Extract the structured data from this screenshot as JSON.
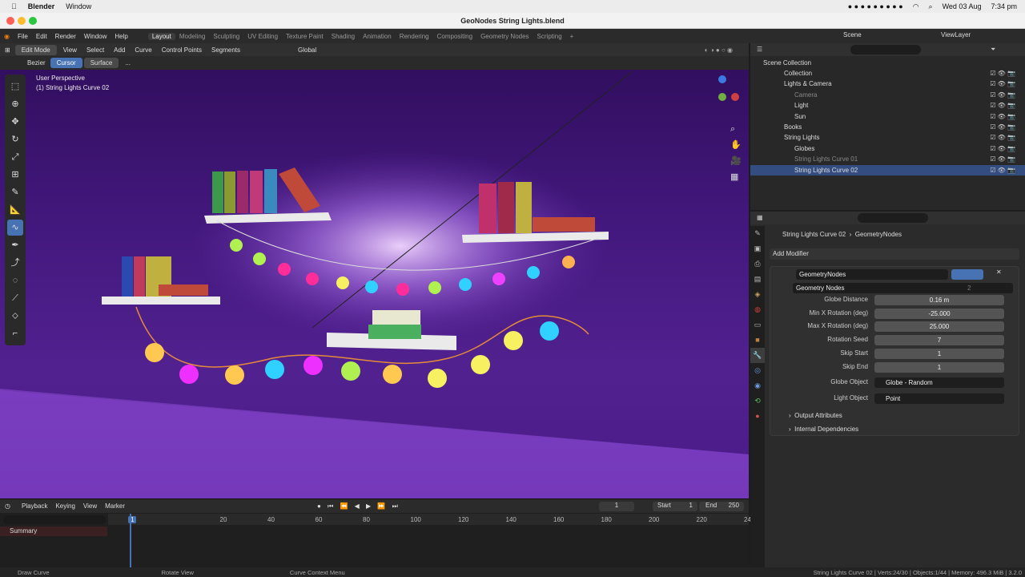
{
  "mac": {
    "app": "Blender",
    "menu_window": "Window",
    "date": "Wed 03 Aug",
    "time": "7:34 pm",
    "badge": "8"
  },
  "window_title": "GeoNodes String Lights.blend",
  "menu": [
    "File",
    "Edit",
    "Render",
    "Window",
    "Help"
  ],
  "workspaces": [
    "Layout",
    "Modeling",
    "Sculpting",
    "UV Editing",
    "Texture Paint",
    "Shading",
    "Animation",
    "Rendering",
    "Compositing",
    "Geometry Nodes",
    "Scripting"
  ],
  "active_workspace": "Layout",
  "scene": "Scene",
  "view_layer": "ViewLayer",
  "vp_header": {
    "mode": "Edit Mode",
    "menus": [
      "View",
      "Select",
      "Add",
      "Curve",
      "Control Points",
      "Segments"
    ],
    "orientation": "Global"
  },
  "vp_sub": {
    "type": "Bezier",
    "cursor": "Cursor",
    "surface": "Surface",
    "more": "..."
  },
  "viewport": {
    "perspective": "User Perspective",
    "object": "(1) String Lights Curve 02"
  },
  "outliner": {
    "title": "Scene Collection",
    "rows": [
      {
        "label": "Collection",
        "depth": 1
      },
      {
        "label": "Lights & Camera",
        "depth": 1
      },
      {
        "label": "Camera",
        "depth": 2
      },
      {
        "label": "Light",
        "depth": 2
      },
      {
        "label": "Sun",
        "depth": 2
      },
      {
        "label": "Books",
        "depth": 1
      },
      {
        "label": "String Lights",
        "depth": 1
      },
      {
        "label": "Globes",
        "depth": 2
      },
      {
        "label": "String Lights Curve 01",
        "depth": 2
      },
      {
        "label": "String Lights Curve 02",
        "depth": 2
      }
    ]
  },
  "props": {
    "breadcrumb_obj": "String Lights Curve 02",
    "breadcrumb_mod": "GeometryNodes",
    "add_modifier": "Add Modifier",
    "modifier_name": "GeometryNodes",
    "node_group": "Geometry Nodes",
    "users": "2",
    "fields": [
      {
        "label": "Globe Distance",
        "value": "0.16 m"
      },
      {
        "label": "Min X Rotation (deg)",
        "value": "-25.000"
      },
      {
        "label": "Max X Rotation (deg)",
        "value": "25.000"
      },
      {
        "label": "Rotation Seed",
        "value": "7"
      },
      {
        "label": "Skip Start",
        "value": "1"
      },
      {
        "label": "Skip End",
        "value": "1"
      }
    ],
    "globe_object_label": "Globe Object",
    "globe_object": "Globe - Random",
    "light_object_label": "Light Object",
    "light_object": "Point",
    "output_attr": "Output Attributes",
    "internal_dep": "Internal Dependencies"
  },
  "timeline": {
    "menus": [
      "Playback",
      "Keying",
      "View",
      "Marker"
    ],
    "current": "1",
    "start_label": "Start",
    "start": "1",
    "end_label": "End",
    "end": "250",
    "summary": "Summary",
    "ticks": [
      "1",
      "20",
      "40",
      "60",
      "80",
      "100",
      "120",
      "140",
      "160",
      "180",
      "200",
      "220",
      "240"
    ]
  },
  "status": {
    "left": "Draw Curve",
    "mid": "Rotate View",
    "ctx": "Curve Context Menu",
    "right": "String Lights Curve 02 | Verts:24/30 | Objects:1/44 | Memory: 496.3 MiB | 3.2.0"
  }
}
